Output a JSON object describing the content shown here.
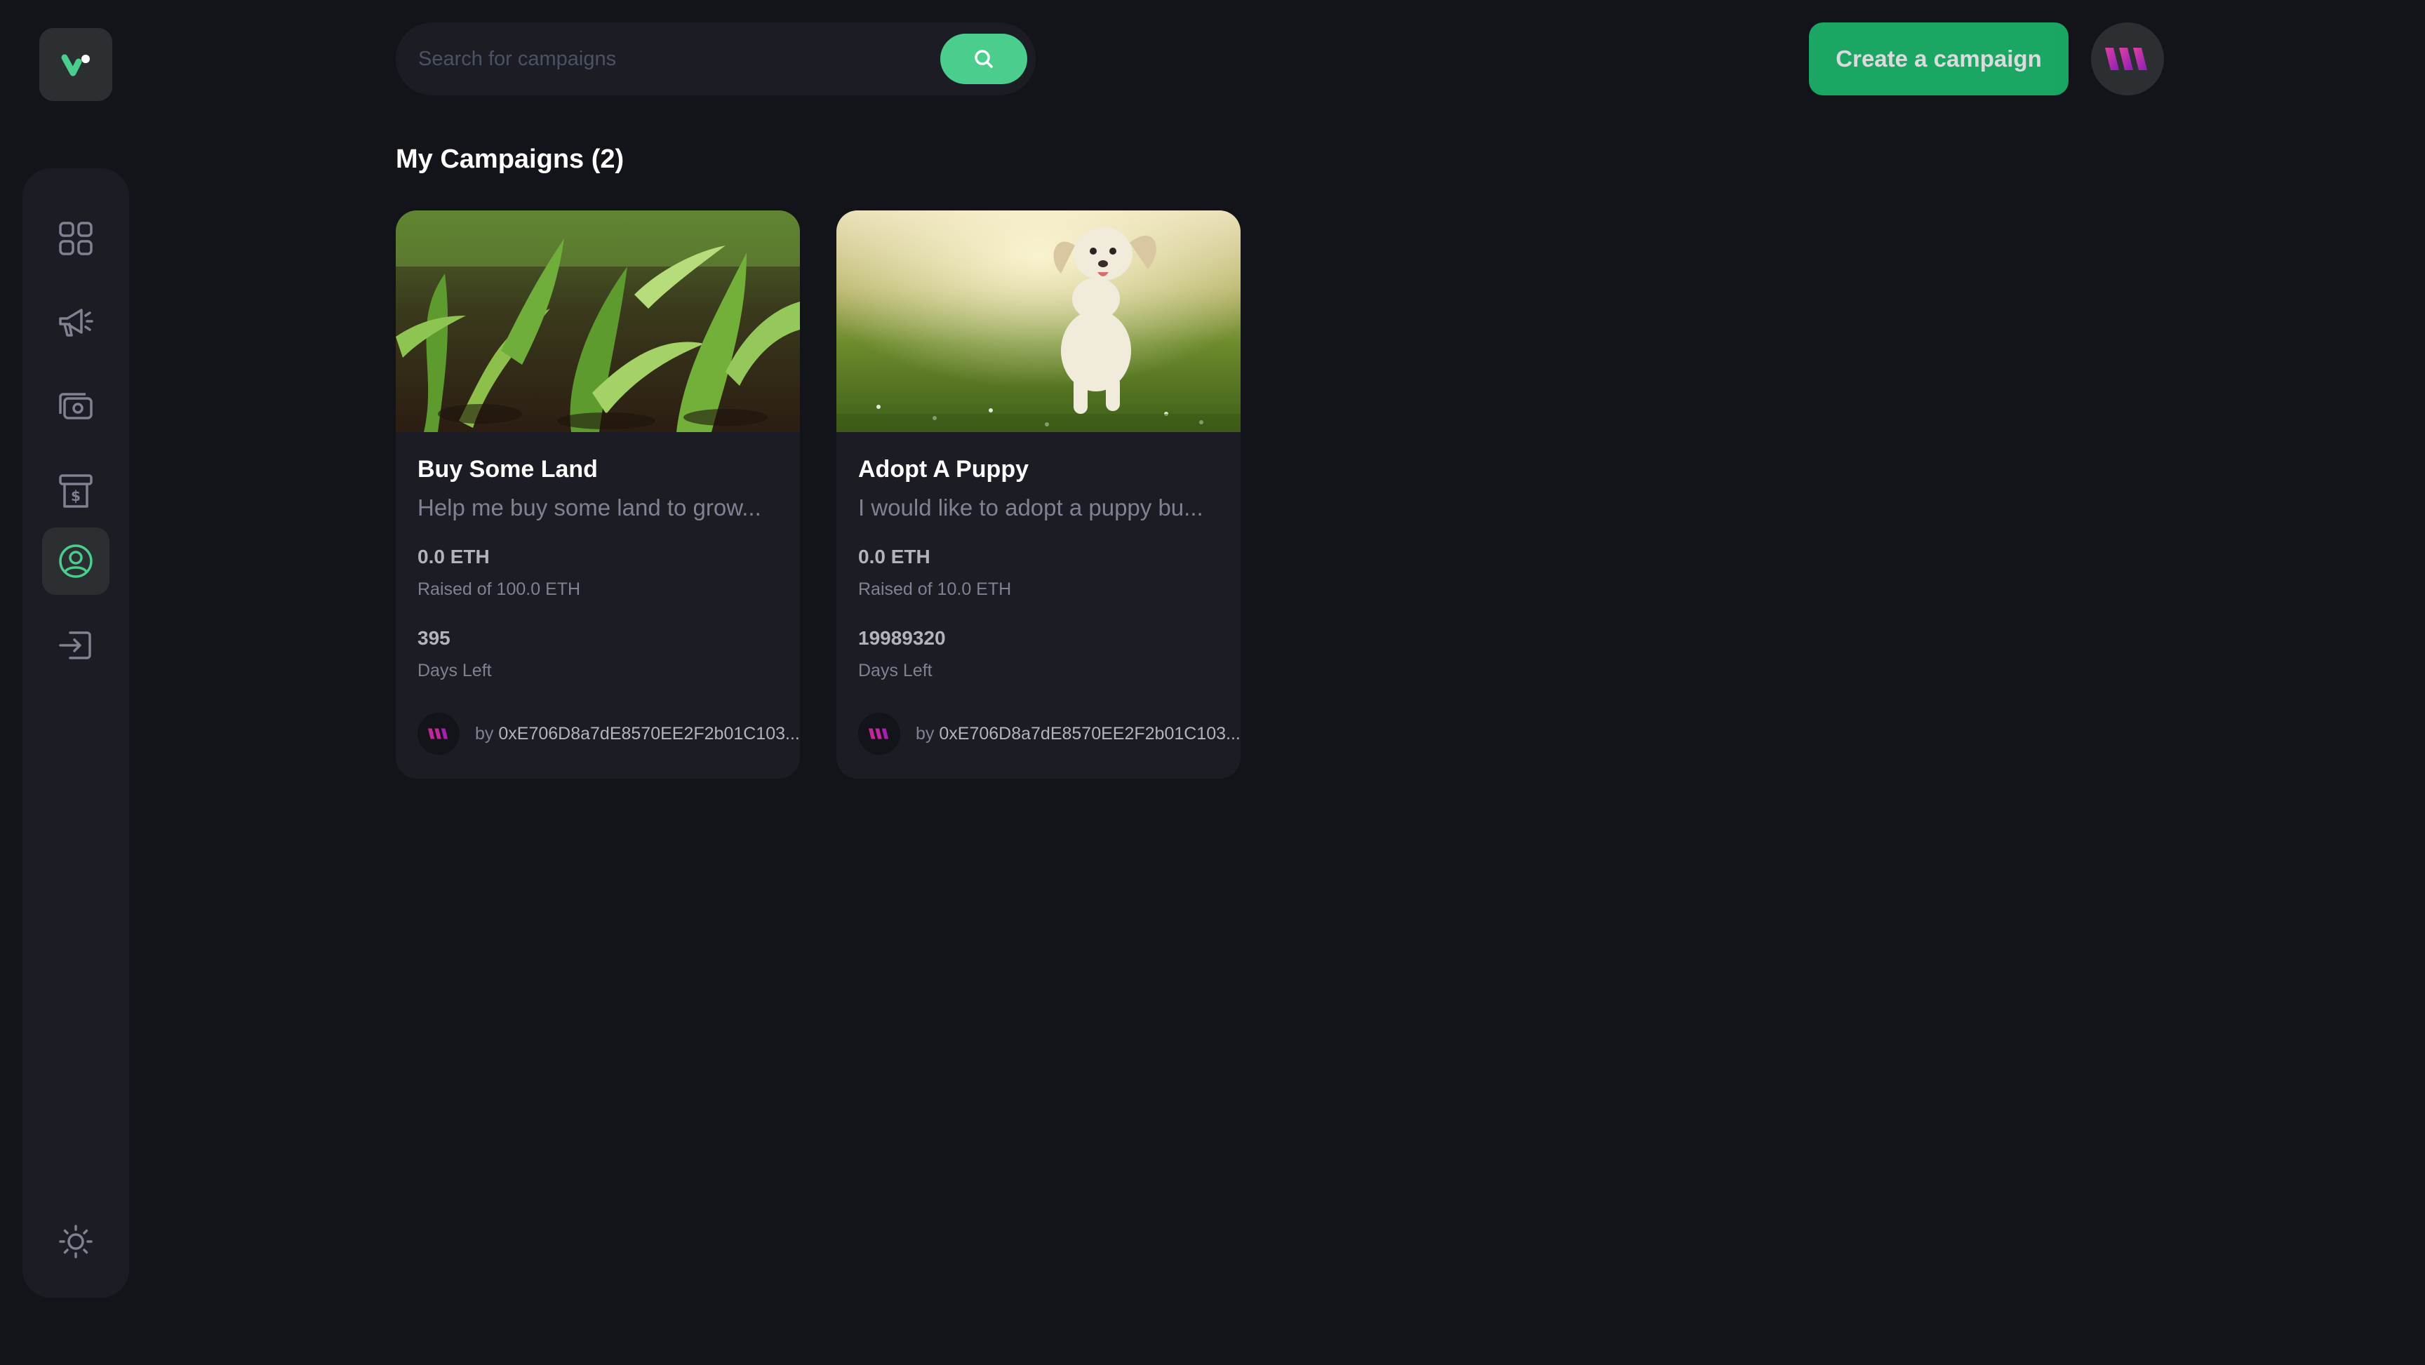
{
  "search": {
    "placeholder": "Search for campaigns"
  },
  "header": {
    "create_label": "Create a campaign"
  },
  "sidebar": {
    "items": [
      {
        "name": "dashboard",
        "icon": "grid-icon",
        "active": false
      },
      {
        "name": "campaign",
        "icon": "megaphone-icon",
        "active": false
      },
      {
        "name": "payment",
        "icon": "money-icon",
        "active": false
      },
      {
        "name": "withdraw",
        "icon": "withdraw-icon",
        "active": false
      },
      {
        "name": "profile",
        "icon": "profile-icon",
        "active": true
      },
      {
        "name": "logout",
        "icon": "logout-icon",
        "active": false
      }
    ],
    "theme_icon": "sun-icon"
  },
  "colors": {
    "accent": "#4acd8d",
    "background": "#13131a",
    "panel": "#1c1c24",
    "brand_pink": "#c3259a"
  },
  "page": {
    "heading": "My Campaigns (2)"
  },
  "campaigns": [
    {
      "title": "Buy Some Land",
      "description": "Help me buy some land to grow...",
      "raised": "0.0 ETH",
      "raised_of": "Raised of 100.0 ETH",
      "days": "395",
      "days_label": "Days Left",
      "by": "by",
      "owner": "0xE706D8a7dE8570EE2F2b01C103...",
      "image": "corn-field"
    },
    {
      "title": "Adopt A Puppy",
      "description": "I would like to adopt a puppy bu...",
      "raised": "0.0 ETH",
      "raised_of": "Raised of 10.0 ETH",
      "days": "19989320",
      "days_label": "Days Left",
      "by": "by",
      "owner": "0xE706D8a7dE8570EE2F2b01C103...",
      "image": "puppy-on-grass"
    }
  ]
}
